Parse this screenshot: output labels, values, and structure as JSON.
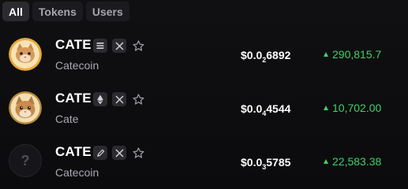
{
  "tabs": [
    {
      "label": "All",
      "active": true
    },
    {
      "label": "Tokens",
      "active": false
    },
    {
      "label": "Users",
      "active": false
    }
  ],
  "tokens": [
    {
      "symbol": "CATE",
      "name": "Catecoin",
      "chain_icon": "solana-icon",
      "price_prefix": "$0.0",
      "price_zeros": "2",
      "price_digits": "6892",
      "change": "290,815.7",
      "change_direction": "up",
      "avatar": "cat-coin-avatar"
    },
    {
      "symbol": "CATE",
      "name": "Cate",
      "chain_icon": "ethereum-icon",
      "price_prefix": "$0.0",
      "price_zeros": "4",
      "price_digits": "4544",
      "change": "10,702.00",
      "change_direction": "up",
      "avatar": "cat-coin-avatar"
    },
    {
      "symbol": "CATE",
      "name": "Catecoin",
      "chain_icon": "pen-icon",
      "price_prefix": "$0.0",
      "price_zeros": "3",
      "price_digits": "5785",
      "change": "22,583.38",
      "change_direction": "up",
      "avatar": "unknown-avatar",
      "avatar_glyph": "?"
    }
  ],
  "colors": {
    "background": "#0c0c0e",
    "positive": "#3fd16a",
    "muted_text": "#a9a9b2",
    "chip": "#2a2a2f"
  }
}
